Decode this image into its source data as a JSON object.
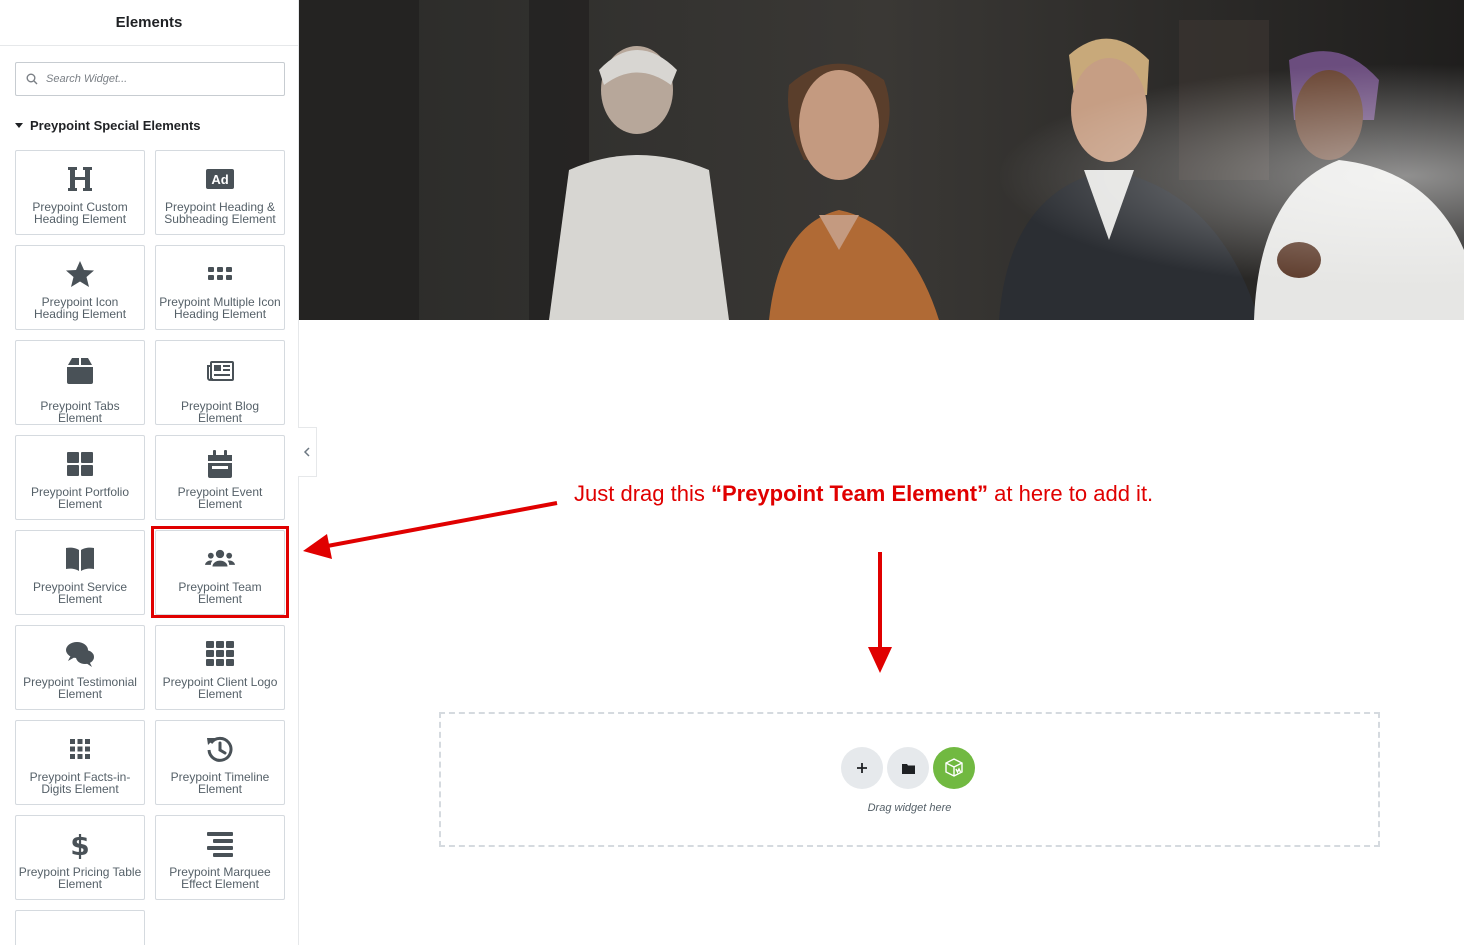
{
  "panel": {
    "title": "Elements"
  },
  "search": {
    "placeholder": "Search Widget..."
  },
  "category": {
    "label": "Preypoint Special Elements"
  },
  "widgets": [
    {
      "label": "Preypoint Custom Heading Element",
      "icon": "heading-icon"
    },
    {
      "label": "Preypoint Heading & Subheading Element",
      "icon": "ad-icon"
    },
    {
      "label": "Preypoint Icon Heading Element",
      "icon": "star-icon"
    },
    {
      "label": "Preypoint Multiple Icon Heading Element",
      "icon": "dots-grid-icon"
    },
    {
      "label": "Preypoint Tabs Element",
      "icon": "box-icon"
    },
    {
      "label": "Preypoint Blog Element",
      "icon": "newspaper-icon"
    },
    {
      "label": "Preypoint Portfolio Element",
      "icon": "grid-squares-icon"
    },
    {
      "label": "Preypoint Event Element",
      "icon": "calendar-icon"
    },
    {
      "label": "Preypoint Service Element",
      "icon": "book-open-icon"
    },
    {
      "label": "Preypoint Team Element",
      "icon": "users-icon"
    },
    {
      "label": "Preypoint Testimonial Element",
      "icon": "comments-icon"
    },
    {
      "label": "Preypoint Client Logo Element",
      "icon": "th-icon"
    },
    {
      "label": "Preypoint Facts-in-Digits Element",
      "icon": "nine-dots-icon"
    },
    {
      "label": "Preypoint Timeline Element",
      "icon": "history-icon"
    },
    {
      "label": "Preypoint Pricing Table Element",
      "icon": "dollar-icon"
    },
    {
      "label": "Preypoint Marquee Effect Element",
      "icon": "align-lines-icon"
    },
    {
      "label": "",
      "icon": "spinner-icon"
    }
  ],
  "annotation": {
    "prefix": "Just drag this ",
    "highlight": "“Preypoint Team Element”",
    "suffix": " at here to add it.",
    "color": "#e00000"
  },
  "dropzone": {
    "text": "Drag widget here",
    "add_icon": "plus-icon",
    "template_icon": "folder-icon",
    "extra_icon": "cube-logo-icon"
  },
  "colors": {
    "icon": "#495157",
    "accent_green": "#71b941",
    "annotation_red": "#e00000"
  }
}
